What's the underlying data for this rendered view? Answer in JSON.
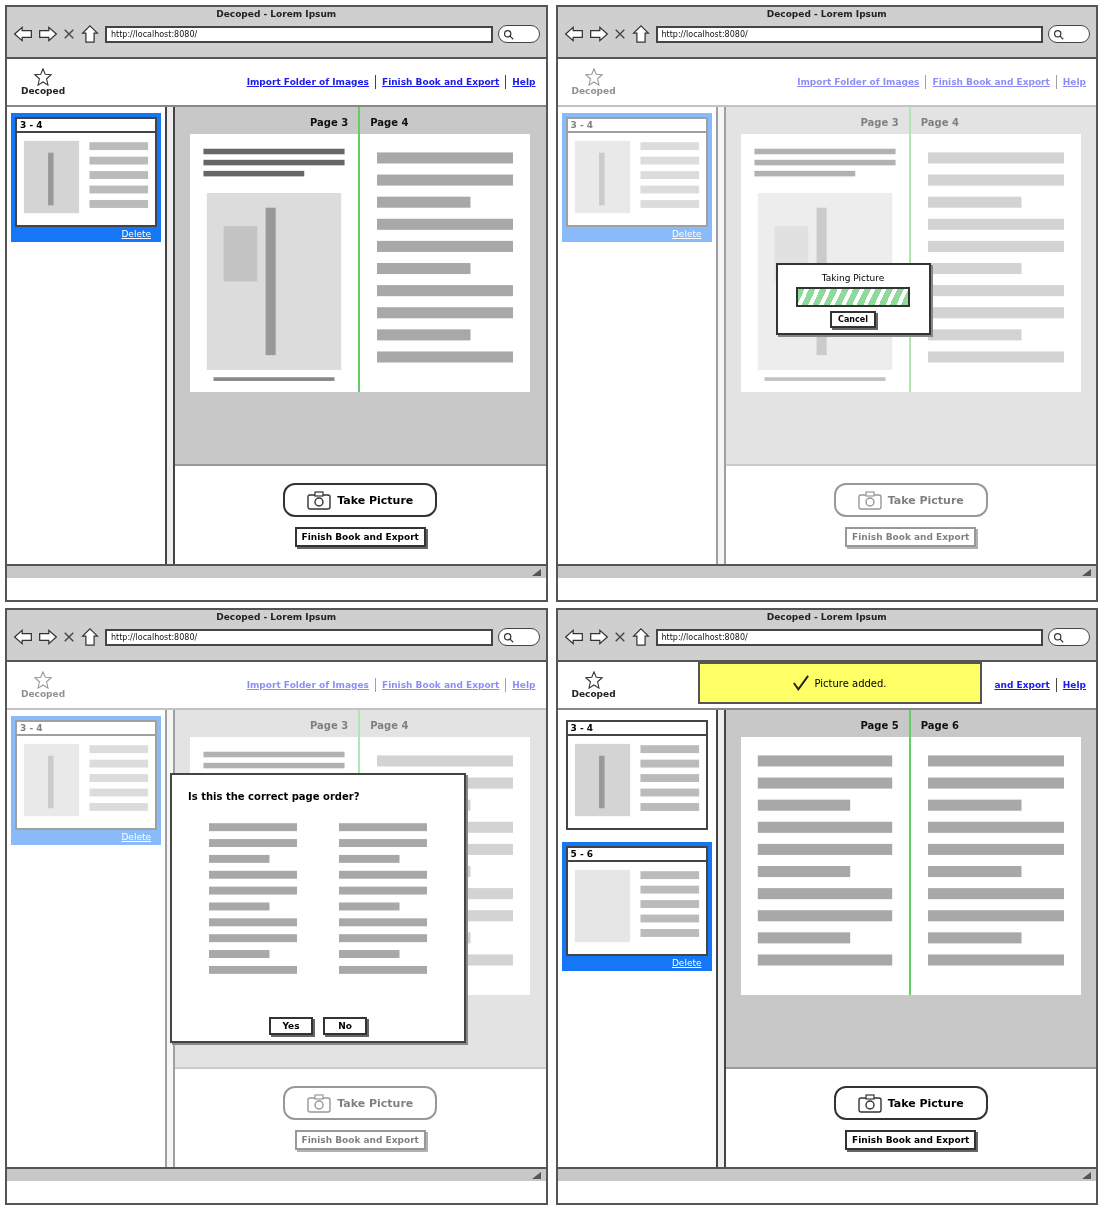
{
  "windows": [
    {
      "title": "Decoped - Lorem Ipsum",
      "url": "http://localhost:8080/",
      "brand": "Decoped",
      "links": [
        "Import Folder of Images",
        "Finish Book and Export",
        "Help"
      ],
      "dimmed": false,
      "thumbnails": [
        {
          "label": "3 - 4",
          "selected": true,
          "action": "Delete"
        }
      ],
      "spread": {
        "pages": [
          "Page 3",
          "Page 4"
        ]
      },
      "buttons": {
        "primary": "Take Picture",
        "secondary": "Finish Book and Export"
      }
    },
    {
      "title": "Decoped - Lorem Ipsum",
      "url": "http://localhost:8080/",
      "brand": "Decoped",
      "links": [
        "Import Folder of Images",
        "Finish Book and Export",
        "Help"
      ],
      "dimmed": true,
      "thumbnails": [
        {
          "label": "3 - 4",
          "selected": true,
          "action": "Delete"
        }
      ],
      "spread": {
        "pages": [
          "Page 3",
          "Page 4"
        ]
      },
      "buttons": {
        "primary": "Take Picture",
        "secondary": "Finish Book and Export"
      },
      "modal": {
        "kind": "progress",
        "title": "Taking Picture",
        "level": 1,
        "buttons": [
          "Cancel"
        ]
      }
    },
    {
      "title": "Decoped - Lorem Ipsum",
      "url": "http://localhost:8080/",
      "brand": "Decoped",
      "links": [
        "Import Folder of Images",
        "Finish Book and Export",
        "Help"
      ],
      "dimmed": true,
      "thumbnails": [
        {
          "label": "3 - 4",
          "selected": true,
          "action": "Delete"
        }
      ],
      "spread": {
        "pages": [
          "Page 3",
          "Page 4"
        ]
      },
      "buttons": {
        "primary": "Take Picture",
        "secondary": "Finish Book and Export"
      },
      "modal": {
        "kind": "confirm",
        "title": "Is this the correct page order?",
        "buttons": [
          "Yes",
          "No"
        ]
      }
    },
    {
      "title": "Decoped - Lorem Ipsum",
      "url": "http://localhost:8080/",
      "brand": "Decoped",
      "links": [
        "and Export",
        "Help"
      ],
      "dimmed": false,
      "toast": {
        "text": "Picture added."
      },
      "thumbnails": [
        {
          "label": "3 - 4",
          "selected": false
        },
        {
          "label": "5 - 6",
          "selected": true,
          "action": "Delete"
        }
      ],
      "spread": {
        "pages": [
          "Page 5",
          "Page 6"
        ]
      },
      "buttons": {
        "primary": "Take Picture",
        "secondary": "Finish Book and Export"
      }
    }
  ]
}
